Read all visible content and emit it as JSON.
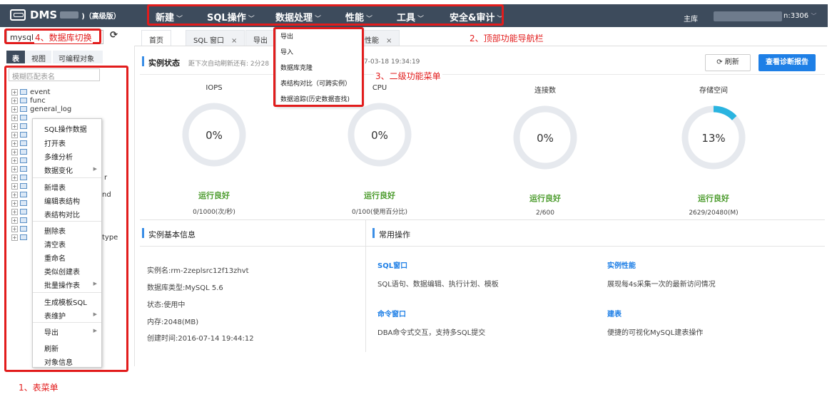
{
  "app": {
    "name": "DMS",
    "edition": ")（高级版）"
  },
  "nav": [
    {
      "label": "新建"
    },
    {
      "label": "SQL操作"
    },
    {
      "label": "数据处理"
    },
    {
      "label": "性能"
    },
    {
      "label": "工具"
    },
    {
      "label": "安全&审计"
    }
  ],
  "host": {
    "label": "主库",
    "port_suffix": "n:3306"
  },
  "dbselector": {
    "value": "mysql"
  },
  "left_tabs": [
    "表",
    "视图",
    "可编程对象"
  ],
  "filter": {
    "placeholder": "模糊匹配表名"
  },
  "tree": [
    {
      "name": "event"
    },
    {
      "name": "func"
    },
    {
      "name": "general_log"
    },
    {
      "name": ""
    },
    {
      "name": ""
    },
    {
      "name": ""
    },
    {
      "name": ""
    },
    {
      "name": ""
    },
    {
      "name": ""
    },
    {
      "name": ""
    },
    {
      "name": "r"
    },
    {
      "name": ""
    },
    {
      "name": "nd"
    },
    {
      "name": ""
    },
    {
      "name": ""
    },
    {
      "name": ""
    },
    {
      "name": ""
    },
    {
      "name": "type"
    }
  ],
  "context_menu": [
    "SQL操作数据",
    "打开表",
    "多维分析",
    "数据变化",
    "新增表",
    "编辑表结构",
    "表结构对比",
    "删除表",
    "清空表",
    "重命名",
    "类似创建表",
    "批量操作表",
    "生成模板SQL",
    "表维护",
    "导出",
    "刷新",
    "对象信息"
  ],
  "main_tabs": [
    {
      "label": "首页"
    },
    {
      "label": "SQL 窗口",
      "close": "×"
    },
    {
      "label": "导出",
      "close": "×"
    },
    {
      "label": "性能",
      "close": "×"
    }
  ],
  "status": {
    "title": "实例状态",
    "refresh_note": "距下次自动刷新还有: 2分28",
    "timestamp": "7-03-18 19:34:19",
    "refresh_btn": "⟳  刷新",
    "diag_btn": "查看诊断报告"
  },
  "gauges": [
    {
      "label": "IOPS",
      "value": "0%",
      "pct": 0,
      "status": "运行良好",
      "detail": "0/1000(次/秒)"
    },
    {
      "label": "CPU",
      "value": "0%",
      "pct": 0,
      "status": "运行良好",
      "detail": "0/100(使用百分比)"
    },
    {
      "label": "连接数",
      "value": "0%",
      "pct": 0,
      "status": "运行良好",
      "detail": "2/600"
    },
    {
      "label": "存储空间",
      "value": "13%",
      "pct": 13,
      "status": "运行良好",
      "detail": "2629/20480(M)"
    }
  ],
  "instance_info": {
    "title": "实例基本信息",
    "lines": [
      "实例名:rm-2zeplsrc12f13zhvt",
      "数据库类型:MySQL 5.6",
      "状态:使用中",
      "内存:2048(MB)",
      "创建时间:2016-07-14 19:44:12"
    ]
  },
  "common_ops": {
    "title": "常用操作",
    "items": [
      {
        "title": "SQL窗口",
        "desc": "SQL语句、数据编辑、执行计划、模板"
      },
      {
        "title": "实例性能",
        "desc": "展现每4s采集一次的最新访问情况"
      },
      {
        "title": "命令窗口",
        "desc": "DBA命令式交互，支持多SQL提交"
      },
      {
        "title": "建表",
        "desc": "便捷的可视化MySQL建表操作"
      }
    ]
  },
  "submenu": [
    "导出",
    "导入",
    "数据库克隆",
    "表结构对比（可跨实例）",
    "数据追踪(历史数据查找)"
  ],
  "annotations": {
    "a1": "1、表菜单",
    "a2": "2、顶部功能导航栏",
    "a3": "3、二级功能菜单",
    "a4": "4、数据库切换"
  },
  "colors": {
    "topbar": "#3d4b5c",
    "accent": "#1e7fe6",
    "ok": "#4b9b2c",
    "gauge_fill": "#2ab4e0",
    "annotation": "#e21c1c"
  }
}
